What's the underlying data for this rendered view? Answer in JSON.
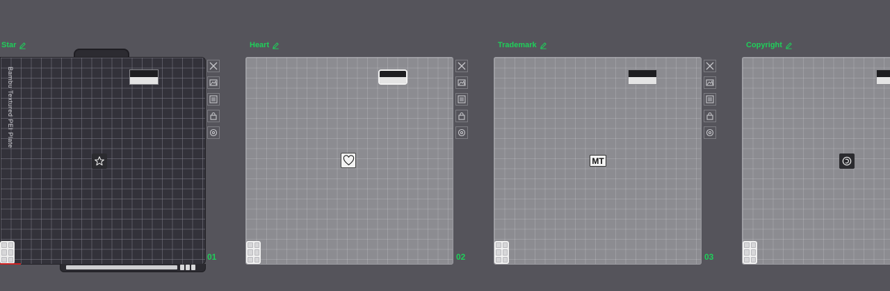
{
  "plates": [
    {
      "label": "Star",
      "number": "01",
      "object": "star-icon",
      "name": "Bambu Textured PEI Plate"
    },
    {
      "label": "Heart",
      "number": "02",
      "object": "heart-icon"
    },
    {
      "label": "Trademark",
      "number": "03",
      "object": "trademark-text",
      "object_text": "MT"
    },
    {
      "label": "Copyright",
      "number": "",
      "object": "copyright-icon"
    }
  ],
  "colors": {
    "background": "#55545b",
    "label_accent": "#1fcf5a",
    "plate_light": "#8c8c91",
    "plate_dark": "#33323a"
  }
}
